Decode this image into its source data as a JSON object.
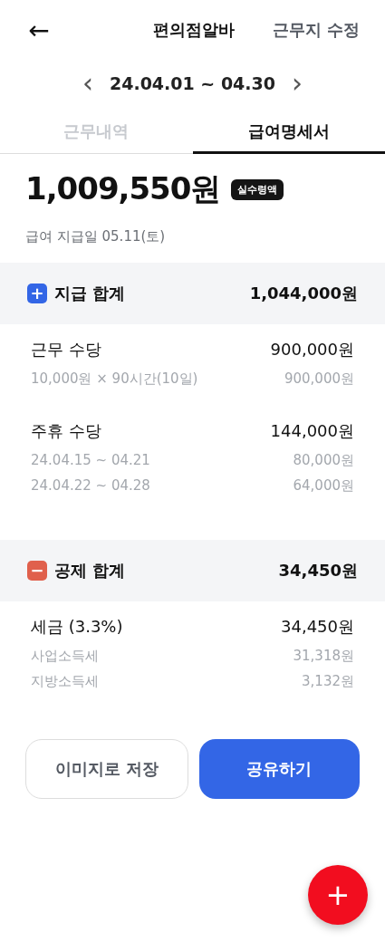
{
  "header": {
    "back": "←",
    "title": "편의점알바",
    "action": "근무지 수정"
  },
  "period": {
    "prev": "‹",
    "label": "24.04.01 ~ 04.30",
    "next": "›"
  },
  "tabs": [
    {
      "label": "근무내역",
      "selected": false
    },
    {
      "label": "급여명세서",
      "selected": true
    }
  ],
  "net_pay": {
    "amount": "1,009,550원",
    "badge": "실수령액",
    "payday": "급여 지급일 05.11(토)"
  },
  "sections": [
    {
      "kind": "plus",
      "icon": "+",
      "title": "지급 합계",
      "total": "1,044,000원",
      "items": [
        {
          "title": "근무 수당",
          "amount": "900,000원",
          "details": [
            {
              "label": "10,000원 × 90시간(10일)",
              "amount": "900,000원"
            }
          ]
        },
        {
          "title": "주휴 수당",
          "amount": "144,000원",
          "details": [
            {
              "label": "24.04.15 ~ 04.21",
              "amount": "80,000원"
            },
            {
              "label": "24.04.22 ~ 04.28",
              "amount": "64,000원"
            }
          ]
        }
      ]
    },
    {
      "kind": "minus",
      "icon": "−",
      "title": "공제 합계",
      "total": "34,450원",
      "items": [
        {
          "title": "세금 (3.3%)",
          "amount": "34,450원",
          "details": [
            {
              "label": "사업소득세",
              "amount": "31,318원"
            },
            {
              "label": "지방소득세",
              "amount": "3,132원"
            }
          ]
        }
      ]
    }
  ],
  "buttons": [
    {
      "kind": "secondary",
      "label": "이미지로 저장"
    },
    {
      "kind": "primary",
      "label": "공유하기"
    }
  ],
  "fab": {
    "label": "+"
  }
}
